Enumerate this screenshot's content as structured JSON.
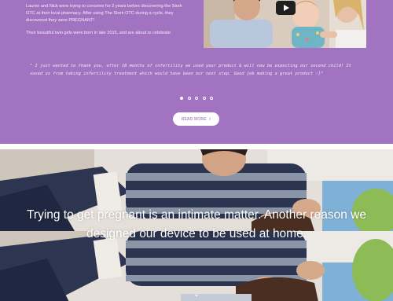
{
  "story": {
    "paragraph_1": "Lauren and Nick were trying to conceive for 2 years before discovering the Stork OTC at their local pharmacy. After using The Stork OTC during a cycle, they discovered they were PREGNANT!",
    "paragraph_2": "Their beautiful twin girls were born in late 2015, and are about to celebrate"
  },
  "video": {
    "play_icon": "youtube-play-icon"
  },
  "testimonial": {
    "quote": "\" I just wanted to thank you, after 18 months of infertility we used your product & will now be expecting our second child! It saved us from taking infertility treatment which would have been our next step. Good job making a great product :)\"",
    "dots_total": 5,
    "active_dot": 1,
    "read_more_label": "READ MORE",
    "read_more_icon": "chevron-right-icon"
  },
  "hero": {
    "headline_line_1": "Trying to get pregnant is an intimate matter. Another reason we",
    "headline_line_2": "designed our device to be used at home.",
    "scroll_icon": "chevron-down-icon"
  },
  "colors": {
    "purple_section": "#a173c0",
    "button_text": "#8f65ad",
    "sweater_stripe_dark": "#2b3550",
    "sweater_stripe_light": "#8a96a8"
  }
}
